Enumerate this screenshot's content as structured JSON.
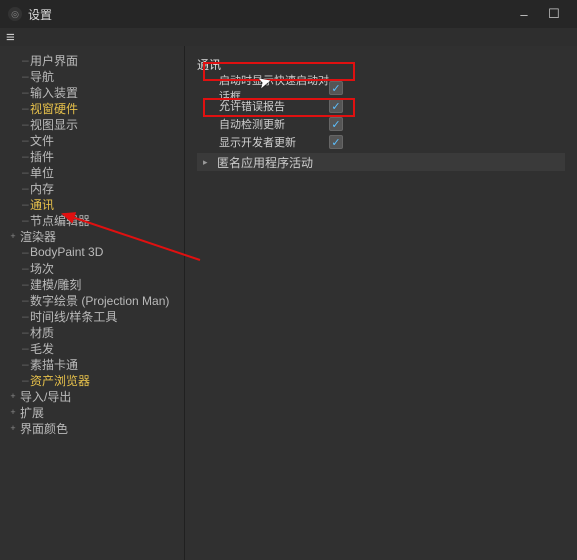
{
  "window": {
    "title": "设置",
    "minimize_label": "–",
    "maximize_label": "☐"
  },
  "sidebar": {
    "items": [
      {
        "label": "用户界面",
        "depth": 1,
        "dash": true
      },
      {
        "label": "导航",
        "depth": 1,
        "dash": true
      },
      {
        "label": "输入装置",
        "depth": 1,
        "dash": true
      },
      {
        "label": "视窗硬件",
        "depth": 1,
        "dash": true,
        "hl": true
      },
      {
        "label": "视图显示",
        "depth": 1,
        "dash": true
      },
      {
        "label": "文件",
        "depth": 1,
        "dash": true
      },
      {
        "label": "插件",
        "depth": 1,
        "dash": true
      },
      {
        "label": "单位",
        "depth": 1,
        "dash": true
      },
      {
        "label": "内存",
        "depth": 1,
        "dash": true
      },
      {
        "label": "通讯",
        "depth": 1,
        "dash": true,
        "hl": true
      },
      {
        "label": "节点编辑器",
        "depth": 1,
        "dash": true
      },
      {
        "label": "渲染器",
        "depth": 0,
        "expander": "+"
      },
      {
        "label": "BodyPaint 3D",
        "depth": 1,
        "dash": true
      },
      {
        "label": "场次",
        "depth": 1,
        "dash": true
      },
      {
        "label": "建模/雕刻",
        "depth": 1,
        "dash": true
      },
      {
        "label": "数字绘景 (Projection Man)",
        "depth": 1,
        "dash": true
      },
      {
        "label": "时间线/样条工具",
        "depth": 1,
        "dash": true
      },
      {
        "label": "材质",
        "depth": 1,
        "dash": true
      },
      {
        "label": "毛发",
        "depth": 1,
        "dash": true
      },
      {
        "label": "素描卡通",
        "depth": 1,
        "dash": true
      },
      {
        "label": "资产浏览器",
        "depth": 1,
        "dash": true,
        "hl": true
      },
      {
        "label": "导入/导出",
        "depth": 0,
        "expander": "+"
      },
      {
        "label": "扩展",
        "depth": 0,
        "expander": "+"
      },
      {
        "label": "界面颜色",
        "depth": 0,
        "expander": "+"
      }
    ]
  },
  "main": {
    "section_title": "通讯",
    "rows": [
      {
        "label": "启动时显示快速启动对话框",
        "checked": true
      },
      {
        "label": "允许错误报告",
        "checked": true
      },
      {
        "label": "自动检测更新",
        "checked": true
      },
      {
        "label": "显示开发者更新",
        "checked": true
      }
    ],
    "collapse_row": "匿名应用程序活动"
  }
}
